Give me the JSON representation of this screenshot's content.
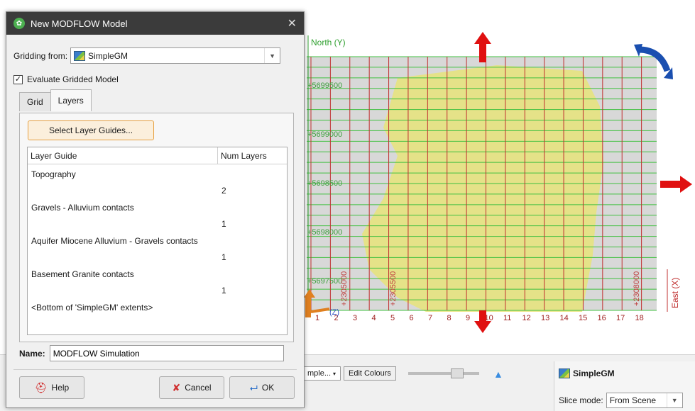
{
  "dialog": {
    "title": "New MODFLOW Model",
    "gridding_from_label": "Gridding from:",
    "gridding_from_value": "SimpleGM",
    "evaluate_label": "Evaluate Gridded Model",
    "evaluate_checked": "✓",
    "tabs": [
      {
        "label": "Grid"
      },
      {
        "label": "Layers"
      }
    ],
    "select_layer_guides": "Select Layer Guides...",
    "table": {
      "headers": [
        "Layer Guide",
        "Num Layers"
      ],
      "rows": [
        {
          "guide": "Topography",
          "num": "2"
        },
        {
          "guide": "Gravels - Alluvium contacts",
          "num": "1"
        },
        {
          "guide": "Aquifer Miocene Alluvium - Gravels contacts",
          "num": "1"
        },
        {
          "guide": "Basement Granite contacts",
          "num": "1"
        },
        {
          "guide": "<Bottom of 'SimpleGM' extents>",
          "num": ""
        }
      ]
    },
    "name_label": "Name:",
    "name_value": "MODFLOW Simulation",
    "help": "Help",
    "cancel": "Cancel",
    "ok": "OK"
  },
  "scene": {
    "north_label": "North (Y)",
    "east_label": "East (X)",
    "z_label": "(Z)",
    "northing_ticks": [
      "+5699500",
      "+5699000",
      "+5698500",
      "+5698000",
      "+5697500"
    ],
    "easting_ticks": [
      "+2305000",
      "+2305500",
      "+2308000"
    ],
    "column_numbers": [
      "1",
      "2",
      "3",
      "4",
      "5",
      "6",
      "7",
      "8",
      "9",
      "10",
      "11",
      "12",
      "13",
      "14",
      "15",
      "16",
      "17",
      "18"
    ],
    "grid_color": "#c03030",
    "row_color": "#40c040",
    "shape_color": "#e8e47a"
  },
  "bottom": {
    "sample_combo": "mple...",
    "edit_colours": "Edit Colours",
    "panel_title": "SimpleGM",
    "slice_mode_label": "Slice mode:",
    "slice_mode_value": "From Scene"
  }
}
